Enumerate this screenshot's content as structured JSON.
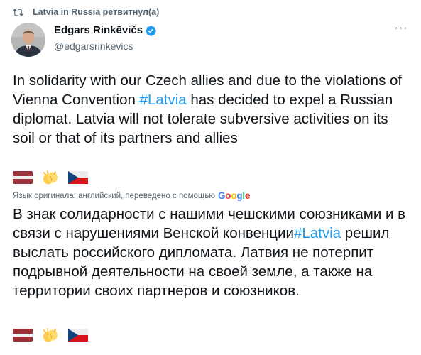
{
  "retweet": {
    "icon": "retweet-icon",
    "account": "Latvia in Russia",
    "suffix": " ретвитнул(а)"
  },
  "author": {
    "name": "Edgars Rinkēvičs",
    "handle": "@edgarsrinkevics",
    "verified_icon": "verified-badge-icon"
  },
  "menu": {
    "more_icon": "more-options-icon",
    "more_label": "···"
  },
  "tweet": {
    "part1": "In solidarity with our Czech allies and due to the violations of Vienna Convention ",
    "hashtag": "#Latvia",
    "part2": " has decided to expel a Russian diplomat. Latvia will not tolerate subversive activities on its soil or that of its partners and allies",
    "emojis": [
      "latvia-flag-icon",
      "clapping-hands-icon",
      "czech-flag-icon"
    ]
  },
  "translation": {
    "note": "Язык оригинала: английский, переведено с помощью",
    "google_logo": "Google",
    "part1": "В знак солидарности с нашими чешскими союзниками и в связи с нарушениями Венской конвенции",
    "hashtag": "#Latvia",
    "part2": " решил выслать российского дипломата. Латвия не потерпит подрывной деятельности на своей земле, а также на территории своих партнеров и союзников.",
    "emojis": [
      "latvia-flag-icon",
      "clapping-hands-icon",
      "czech-flag-icon"
    ]
  },
  "colors": {
    "link": "#1d9bf0",
    "secondary_text": "#536471",
    "latvia_red": "#9e3039",
    "czech_blue": "#11457e",
    "czech_red": "#d7141a",
    "clap_yellow": "#ffcc4d"
  }
}
